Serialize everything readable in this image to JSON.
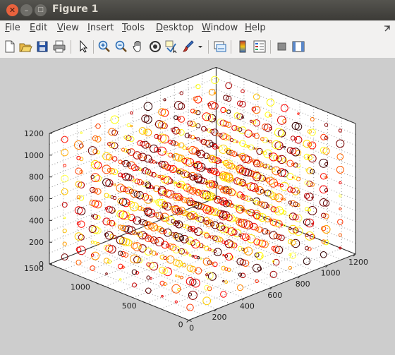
{
  "window": {
    "title": "Figure 1",
    "buttons": [
      "close",
      "minimize",
      "maximize"
    ]
  },
  "menu": {
    "items": [
      {
        "label": "File",
        "mnemonic": "F",
        "rest": "ile"
      },
      {
        "label": "Edit",
        "mnemonic": "E",
        "rest": "dit"
      },
      {
        "label": "View",
        "mnemonic": "V",
        "rest": "iew"
      },
      {
        "label": "Insert",
        "mnemonic": "I",
        "rest": "nsert"
      },
      {
        "label": "Tools",
        "mnemonic": "T",
        "rest": "ools"
      },
      {
        "label": "Desktop",
        "mnemonic": "D",
        "rest": "esktop"
      },
      {
        "label": "Window",
        "mnemonic": "W",
        "rest": "indow"
      },
      {
        "label": "Help",
        "mnemonic": "H",
        "rest": "elp"
      }
    ],
    "overflow_icon": "dock-arrow-icon"
  },
  "toolbar": {
    "buttons": [
      "new-figure-icon",
      "open-file-icon",
      "save-icon",
      "print-icon",
      "select-arrow-icon",
      "zoom-in-icon",
      "zoom-out-icon",
      "pan-hand-icon",
      "rotate-3d-icon",
      "data-cursor-icon",
      "brush-icon",
      "brush-dropdown-icon",
      "link-plot-icon",
      "colorbar-icon",
      "legend-icon",
      "hide-plot-tools-icon",
      "show-plot-tools-icon"
    ]
  },
  "colors": {
    "figure_bg": "#cdcdcd",
    "axes_bg": "#ffffff",
    "marker_colormap": "hot"
  },
  "chart_data": {
    "type": "scatter",
    "dimension": "3d",
    "marker": "open-circle",
    "grid": true,
    "title": "",
    "xlabel": "",
    "ylabel": "",
    "zlabel": "",
    "xlim": [
      0,
      1200
    ],
    "ylim": [
      0,
      1500
    ],
    "zlim": [
      0,
      1200
    ],
    "xticks": [
      "0",
      "200",
      "400",
      "600",
      "800",
      "1000",
      "1200"
    ],
    "yticks": [
      "0",
      "500",
      "1000",
      "1500"
    ],
    "zticks": [
      "0",
      "200",
      "400",
      "600",
      "800",
      "1000",
      "1200"
    ],
    "grid_x": [
      100,
      200,
      300,
      400,
      500,
      600,
      700,
      800,
      900,
      1000,
      1100
    ],
    "grid_y": [
      150,
      300,
      450,
      600,
      750,
      900,
      1050,
      1200,
      1350
    ],
    "grid_z": [
      100,
      200,
      300,
      400,
      500,
      600,
      700,
      800,
      900,
      1000,
      1100
    ],
    "size_range": [
      1,
      6
    ],
    "color_range": [
      0,
      1
    ]
  }
}
